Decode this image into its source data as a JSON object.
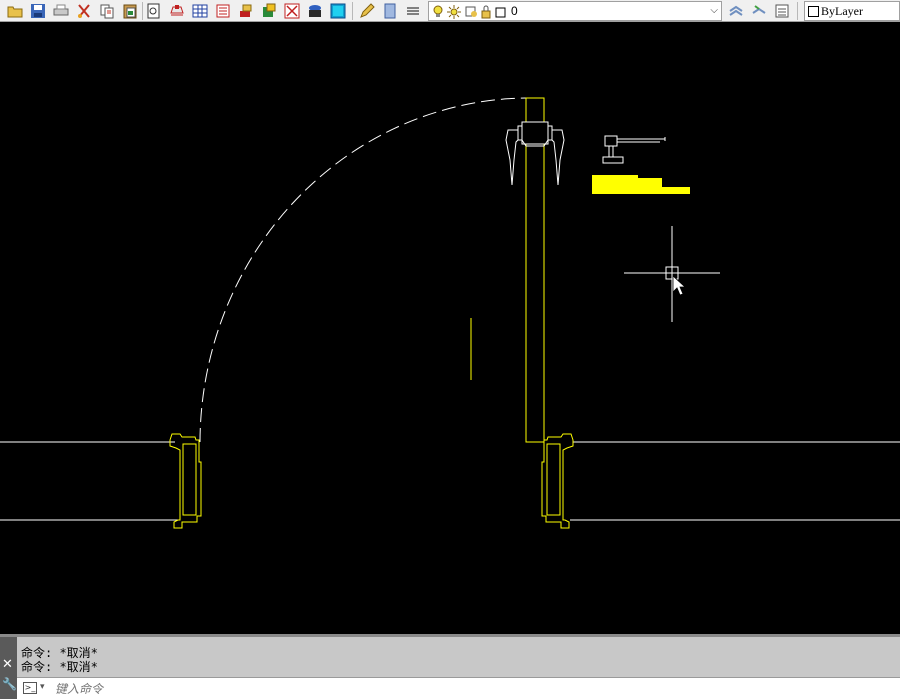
{
  "toolbar": {
    "buttons": [
      "open-icon",
      "save-icon",
      "plot-icon",
      "cut-icon",
      "copy-icon",
      "paste-icon",
      "properties-icon",
      "layer-manager-icon",
      "table-icon",
      "block-icon",
      "insert-icon",
      "hatch-icon",
      "match-properties-icon",
      "matchprop-paint-icon",
      "fill-icon"
    ],
    "layer": {
      "value": "0"
    },
    "color_value": "ByLayer"
  },
  "drawing": {
    "background": "#000000",
    "wall_color": "#ffffff",
    "door_color": "#ffff00",
    "swing_color": "#ffffff"
  },
  "command": {
    "history": [
      "命令: *取消*",
      "命令: *取消*"
    ],
    "placeholder": "键入命令"
  }
}
